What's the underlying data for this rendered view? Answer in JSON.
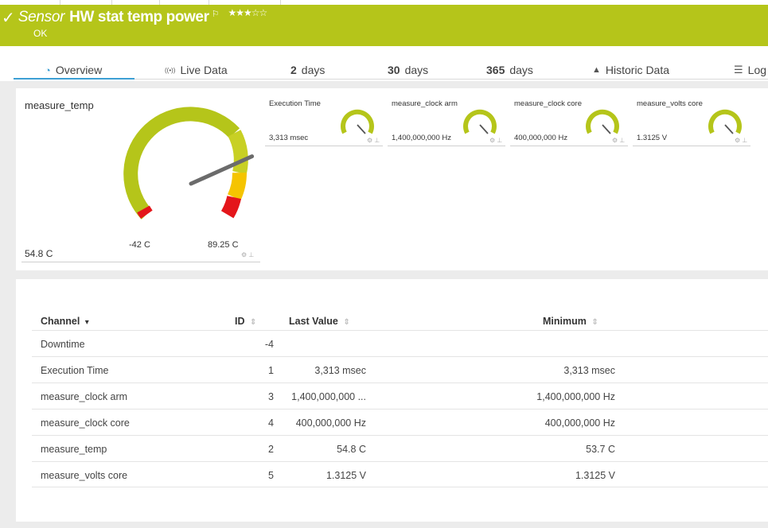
{
  "header": {
    "check_glyph": "✓",
    "sensor_word": "Sensor",
    "sensor_name": "HW stat temp power",
    "flag_glyph": "⚐",
    "stars": "★★★☆☆",
    "status": "OK",
    "background_color": "#b5c51a"
  },
  "tabs": [
    {
      "icon": "◔",
      "num": "",
      "label": "Overview"
    },
    {
      "icon": "((•))",
      "num": "",
      "label": "Live Data"
    },
    {
      "icon": "",
      "num": "2",
      "label": "days"
    },
    {
      "icon": "",
      "num": "30",
      "label": "days"
    },
    {
      "icon": "▲",
      "num": "",
      "label": "Historic Data"
    },
    {
      "icon": "☰",
      "num": "",
      "label": "Log"
    },
    {
      "icon": "",
      "num": "365",
      "label": "days"
    }
  ],
  "big_gauge": {
    "title": "measure_temp",
    "value": "54.8 C",
    "min_label": "-42 C",
    "max_label": "89.25 C",
    "value_fraction": 0.735
  },
  "mini_gauges": [
    {
      "title": "Execution Time",
      "value": "3,313 msec"
    },
    {
      "title": "measure_clock arm",
      "value": "1,400,000,000 Hz"
    },
    {
      "title": "measure_clock core",
      "value": "400,000,000 Hz"
    },
    {
      "title": "measure_volts core",
      "value": "1.3125 V"
    }
  ],
  "gauge_icons": "⚙ ⊥",
  "table": {
    "headers": {
      "channel": "Channel",
      "channel_sort": "▾",
      "id": "ID",
      "last_value": "Last Value",
      "minimum": "Minimum",
      "sort_icon": "⇕"
    },
    "rows": [
      {
        "channel": "Downtime",
        "id": "-4",
        "last": "",
        "min": ""
      },
      {
        "channel": "Execution Time",
        "id": "1",
        "last": "3,313 msec",
        "min": "3,313 msec"
      },
      {
        "channel": "measure_clock arm",
        "id": "3",
        "last": "1,400,000,000 ...",
        "min": "1,400,000,000 Hz"
      },
      {
        "channel": "measure_clock core",
        "id": "4",
        "last": "400,000,000 Hz",
        "min": "400,000,000 Hz"
      },
      {
        "channel": "measure_temp",
        "id": "2",
        "last": "54.8 C",
        "min": "53.7 C"
      },
      {
        "channel": "measure_volts core",
        "id": "5",
        "last": "1.3125 V",
        "min": "1.3125 V"
      }
    ]
  }
}
